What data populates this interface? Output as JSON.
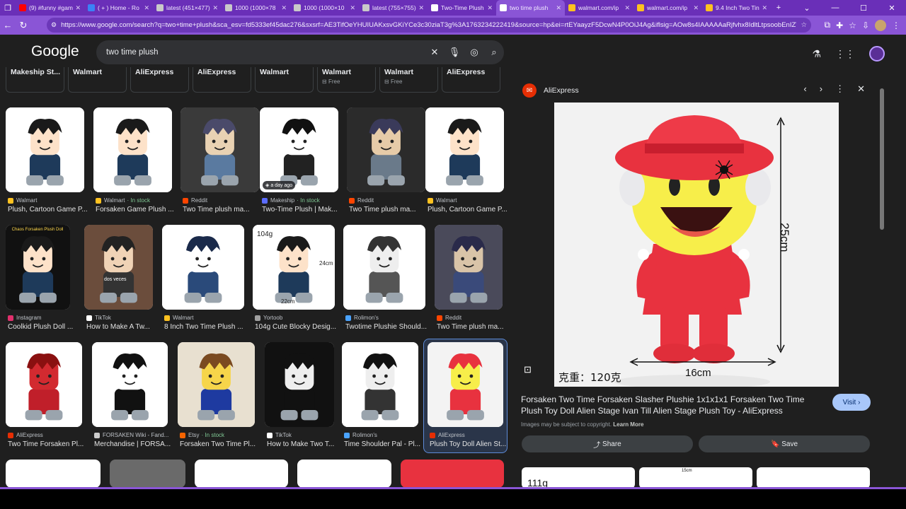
{
  "tabs": [
    {
      "title": "(9) #funny #gam",
      "icon": "youtube-icon",
      "color": "#ff0000"
    },
    {
      "title": "( + ) Home - Ro",
      "icon": "app-icon",
      "color": "#3b82f6"
    },
    {
      "title": "latest (451×477)",
      "icon": "globe-icon",
      "color": "#c9c9c9"
    },
    {
      "title": "1000 (1000×78",
      "icon": "globe-icon",
      "color": "#c9c9c9"
    },
    {
      "title": "1000 (1000×10",
      "icon": "globe-icon",
      "color": "#c9c9c9"
    },
    {
      "title": "latest (755×755)",
      "icon": "globe-icon",
      "color": "#c9c9c9"
    },
    {
      "title": "Two-Time Plush",
      "icon": "w-icon",
      "color": "#ffffff"
    },
    {
      "title": "two time plush",
      "icon": "google-icon",
      "color": "#ffffff",
      "active": true
    },
    {
      "title": "walmart.com/ip",
      "icon": "walmart-icon",
      "color": "#ffc220"
    },
    {
      "title": "walmart.com/ip",
      "icon": "walmart-icon",
      "color": "#ffc220"
    },
    {
      "title": "9.4 Inch Two Tin",
      "icon": "walmart-icon",
      "color": "#ffc220"
    }
  ],
  "browser": {
    "url": "https://www.google.com/search?q=two+time+plush&sca_esv=fd5333ef45dac276&sxsrf=AE3TifOeYHUIUAKxsvGKiYCe3c30ziaT3g%3A1763234222419&source=hp&ei=rtEYaayzF5DcwN4P0OiJ4Ag&iflsig=AOw8s4IAAAAAaRjfvhx8IdltLtpsoobEnIZVatTArIEU..."
  },
  "google": {
    "logo": "Google",
    "query": "two time plush"
  },
  "chips": [
    {
      "label": "Makeship St..."
    },
    {
      "label": "Walmart"
    },
    {
      "label": "AliExpress"
    },
    {
      "label": "AliExpress"
    },
    {
      "label": "Walmart"
    },
    {
      "label": "Walmart",
      "sub": "Free"
    },
    {
      "label": "Walmart",
      "sub": "Free"
    },
    {
      "label": "AliExpress"
    }
  ],
  "results": [
    {
      "source": "Walmart",
      "title": "Plush, Cartoon Game P...",
      "favcolor": "#ffc220"
    },
    {
      "source": "Walmart",
      "stock": "In stock",
      "title": "Forsaken Game Plush ...",
      "favcolor": "#ffc220"
    },
    {
      "source": "Reddit",
      "title": "Two Time plush ma...",
      "favcolor": "#ff4500"
    },
    {
      "source": "Makeship",
      "stock": "In stock",
      "title": "Two-Time Plush | Mak...",
      "favcolor": "#5b6cff",
      "badge": "a day ago"
    },
    {
      "source": "Reddit",
      "title": "Two Time plush ma...",
      "favcolor": "#ff4500"
    },
    {
      "source": "Walmart",
      "title": "Plush, Cartoon Game P...",
      "favcolor": "#ffc220"
    },
    {
      "source": "Instagram",
      "title": "Coolkid Plush Doll ...",
      "favcolor": "#e1306c"
    },
    {
      "source": "TikTok",
      "title": "How to Make A Tw...",
      "favcolor": "#ffffff"
    },
    {
      "source": "Walmart",
      "title": "8 Inch Two Time Plush ...",
      "favcolor": "#ffc220"
    },
    {
      "source": "Yortoob",
      "title": "104g Cute Blocky Desig...",
      "favcolor": "#a0a0a0"
    },
    {
      "source": "Rolimon's",
      "title": "Twotime Plushie Should...",
      "favcolor": "#4aa3ff"
    },
    {
      "source": "Reddit",
      "title": "Two Time plush ma...",
      "favcolor": "#ff4500"
    },
    {
      "source": "AliExpress",
      "title": "Two Time Forsaken Pl...",
      "favcolor": "#e62e04"
    },
    {
      "source": "FORSAKEN Wiki - Fand...",
      "title": "Merchandise | FORSA...",
      "favcolor": "#cccccc"
    },
    {
      "source": "Etsy",
      "stock": "In stock",
      "title": "Forsaken Two Time Pl...",
      "favcolor": "#f56400"
    },
    {
      "source": "TikTok",
      "title": "How to Make Two T...",
      "favcolor": "#ffffff"
    },
    {
      "source": "Rolimon's",
      "title": "Time Shoulder Pal - Pl...",
      "favcolor": "#4aa3ff"
    },
    {
      "source": "AliExpress",
      "title": "Plush Toy Doll Alien St...",
      "favcolor": "#e62e04"
    }
  ],
  "image_texts": {
    "thumb_104g": "104g",
    "thumb_24cm": "24cm",
    "thumb_22cm": "22cm",
    "thumb_dos": "dos veces",
    "thumb_chaos": "Chaos Forsaken Plush Doll",
    "main_25cm": "25cm",
    "main_16cm": "16cm",
    "main_weight": "克重：120克",
    "related_111g": "111g",
    "related_15cm": "15cm"
  },
  "panel": {
    "source": "AliExpress",
    "title": "Forsaken Two Time Forsaken Slasher Plushie 1x1x1x1 Forsaken Two Time Plush Toy Doll Alien Stage Ivan Till Alien Stage Plush Toy - AliExpress",
    "visit_label": "Visit",
    "copyright": "Images may be subject to copyright.",
    "learn_more": "Learn More",
    "share_label": "Share",
    "save_label": "Save"
  }
}
